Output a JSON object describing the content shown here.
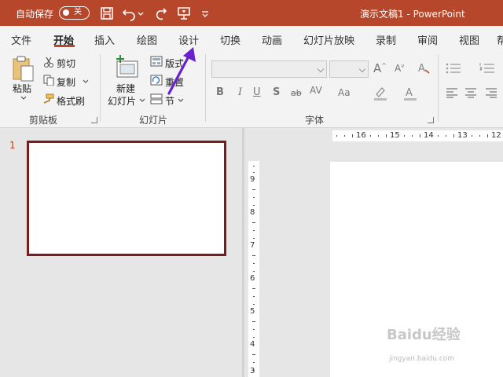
{
  "titlebar": {
    "autosave_label": "自动保存",
    "autosave_state": "关",
    "doc_title": "演示文稿1 - PowerPoint"
  },
  "tabs": [
    "文件",
    "开始",
    "插入",
    "绘图",
    "设计",
    "切换",
    "动画",
    "幻灯片放映",
    "录制",
    "审阅",
    "视图",
    "帮"
  ],
  "active_tab": "开始",
  "clipboard": {
    "paste": "粘贴",
    "cut": "剪切",
    "copy": "复制",
    "format_painter": "格式刷",
    "group_label": "剪贴板"
  },
  "slides": {
    "new_slide_line1": "新建",
    "new_slide_line2": "幻灯片",
    "layout": "版式",
    "reset": "重置",
    "section": "节",
    "group_label": "幻灯片"
  },
  "font": {
    "group_label": "字体",
    "font_name": "",
    "font_size": ""
  },
  "thumbnail": {
    "slide_number": "1"
  },
  "hruler": [
    "16",
    "15",
    "14",
    "13",
    "12"
  ],
  "vruler": [
    "9",
    "8",
    "7",
    "6",
    "5",
    "4",
    "3"
  ],
  "watermark": {
    "text": "Baidu经验",
    "sub": "jingyan.baidu.com"
  },
  "colors": {
    "accent": "#b7472a",
    "arrow": "#6a1fd1",
    "thumb_border": "#7b1c1c"
  }
}
